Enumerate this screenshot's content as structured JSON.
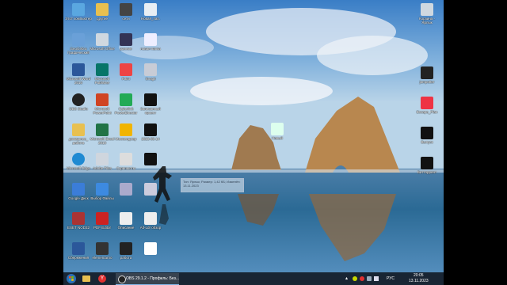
{
  "desktop": {
    "icons_col1": [
      {
        "label": "Этот компьютер",
        "icon": "computer-icon",
        "color": "#5aa7e0"
      },
      {
        "label": "GeoGebra Графический",
        "icon": "app-icon",
        "color": "#6aa0d8"
      },
      {
        "label": "Microsoft Word 2010",
        "icon": "word-icon",
        "color": "#2b579a"
      },
      {
        "label": "OBS Studio",
        "icon": "obs-icon",
        "color": "#222"
      },
      {
        "label": "домашнее_ работа",
        "icon": "folder-icon",
        "color": "#e8c050"
      },
      {
        "label": "Microsoft Edge",
        "icon": "edge-icon",
        "color": "#1f8ad2"
      },
      {
        "label": "Google Диск",
        "icon": "drive-icon",
        "color": "#3b7dd8"
      },
      {
        "label": "ESET NOD32",
        "icon": "eset-icon",
        "color": "#a33"
      },
      {
        "label": "Сбережения",
        "icon": "doc-icon",
        "color": "#2b579a"
      }
    ],
    "icons_col2": [
      {
        "label": "другие",
        "icon": "folder-icon",
        "color": "#e8c050"
      },
      {
        "label": "Microsoft Office",
        "icon": "app-icon",
        "color": "#d0d8e0"
      },
      {
        "label": "Microsoft Publisher",
        "icon": "publisher-icon",
        "color": "#077568"
      },
      {
        "label": "Microsoft PowerPoint",
        "icon": "ppt-icon",
        "color": "#d04423"
      },
      {
        "label": "Microsoft Excel 2010",
        "icon": "excel-icon",
        "color": "#217346"
      },
      {
        "label": "Adobe Files",
        "icon": "app-icon",
        "color": "#cfd6de"
      },
      {
        "label": "Выбор Файлы",
        "icon": "folder-icon",
        "color": "#3d8ae0"
      },
      {
        "label": "PDF Editor",
        "icon": "pdf-icon",
        "color": "#c22"
      },
      {
        "label": "elementarno",
        "icon": "app-icon",
        "color": "#333"
      }
    ],
    "icons_col3": [
      {
        "label": "сети",
        "icon": "network-icon",
        "color": "#444"
      },
      {
        "label": "ранние",
        "icon": "app-icon",
        "color": "#335"
      },
      {
        "label": "Paint",
        "icon": "paint-icon",
        "color": "#e44"
      },
      {
        "label": "Cyberlink PowerDirector",
        "icon": "app-icon",
        "color": "#2a5"
      },
      {
        "label": "Мессенджер",
        "icon": "app-icon",
        "color": "#f1b400"
      },
      {
        "label": "Скриншоты",
        "icon": "app-icon",
        "color": "#ddd"
      },
      {
        "label": "",
        "icon": "app-icon",
        "color": "#aac"
      },
      {
        "label": "Описание",
        "icon": "doc-icon",
        "color": "#eee"
      },
      {
        "label": "работа",
        "icon": "app-icon",
        "color": "#222"
      }
    ],
    "icons_col4": [
      {
        "label": "Новая_пап.",
        "icon": "doc-icon",
        "color": "#e8eef4"
      },
      {
        "label": "новая папка",
        "icon": "doc-icon",
        "color": "#eef"
      },
      {
        "label": "Snagit",
        "icon": "app-icon",
        "color": "#c8ccd6"
      },
      {
        "label": "Записанный проект",
        "icon": "video-icon",
        "color": "#111"
      },
      {
        "label": "2023-08-14",
        "icon": "video-icon",
        "color": "#111"
      },
      {
        "label": "",
        "icon": "video-icon",
        "color": "#111"
      },
      {
        "label": "",
        "icon": "doc-icon",
        "color": "#ccd"
      },
      {
        "label": "Alt-Ldr обзор",
        "icon": "doc-icon",
        "color": "#eee"
      },
      {
        "label": "",
        "icon": "doc-icon",
        "color": "#fff"
      }
    ],
    "icons_right": [
      {
        "label": "Корзина - Ярлык",
        "icon": "trash-icon",
        "color": "#cfd8e0"
      },
      {
        "label": "jampotter",
        "icon": "app-icon",
        "color": "#222"
      },
      {
        "label": "Escape_Plan",
        "icon": "app-icon",
        "color": "#e34"
      },
      {
        "label": "Выпуск",
        "icon": "video-icon",
        "color": "#111"
      },
      {
        "label": "Битторрент",
        "icon": "video-icon",
        "color": "#111"
      }
    ],
    "floating_icon": {
      "label": "Новый",
      "icon": "doc-icon",
      "color": "#dfe"
    },
    "tooltip_text": "Тип: Ярлык; Размер: 1,42 КБ; Изменён: 13.11.2023"
  },
  "taskbar": {
    "app_label": "OBS 29.1.2 - Профиль: Без...",
    "tray": {
      "lang": "РУС",
      "time": "20:05",
      "date": "13.11.2023"
    }
  },
  "colors": {
    "taskbar_bg": "#141c28",
    "accent": "#7fb3e6"
  }
}
